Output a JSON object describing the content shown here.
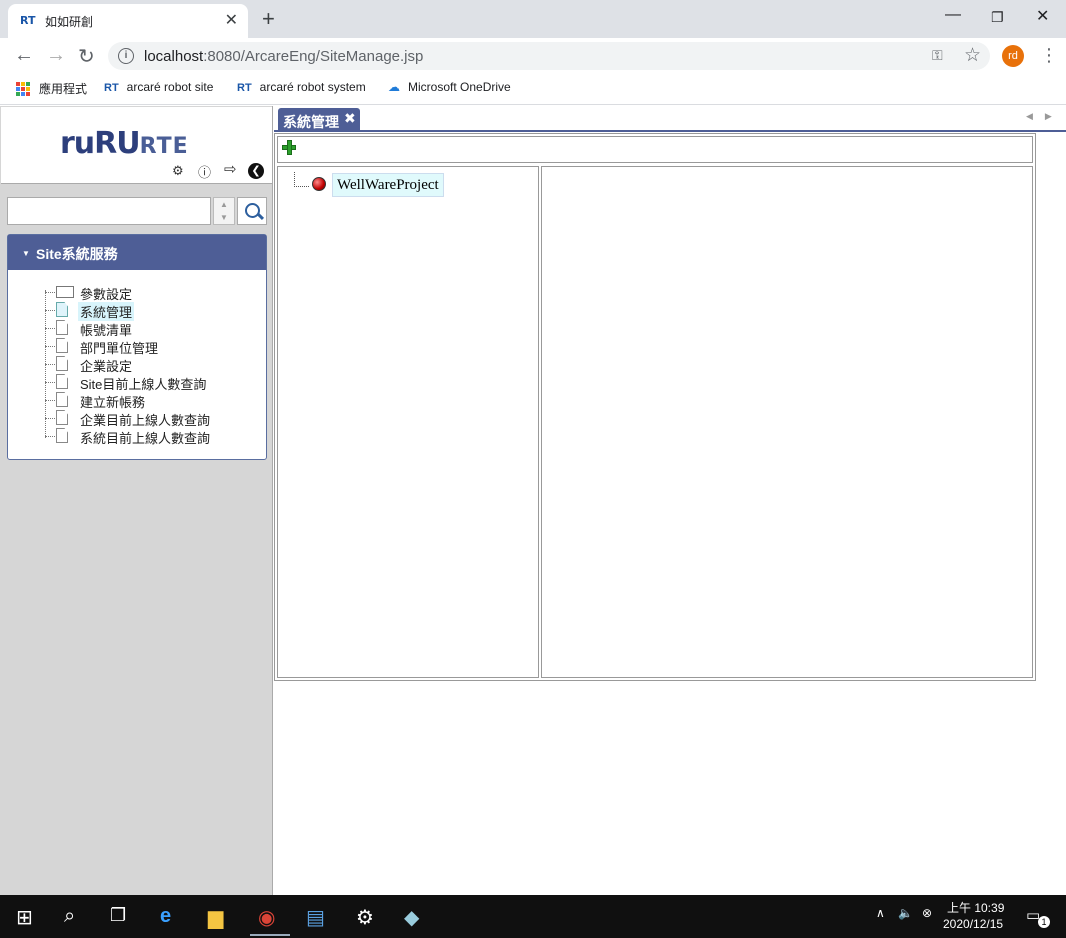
{
  "browser": {
    "tab_title": "如如研創",
    "tab_favicon": "RT",
    "url_host": "localhost",
    "url_rest": ":8080/ArcareEng/SiteManage.jsp",
    "avatar_initials": "rd",
    "bookmarks": [
      {
        "label": "應用程式",
        "icon": "apps-grid-icon"
      },
      {
        "label": "arcaré robot site",
        "icon": "RT"
      },
      {
        "label": "arcaré robot system",
        "icon": "RT"
      },
      {
        "label": "Microsoft OneDrive",
        "icon": "cloud-icon"
      }
    ]
  },
  "app": {
    "logo_main": "ruRU",
    "logo_suffix": "RTE",
    "search_placeholder": "",
    "accordion_title": "Site系統服務",
    "tree": {
      "root": "參數設定",
      "items": [
        {
          "label": "系統管理",
          "selected": true
        },
        {
          "label": "帳號清單",
          "selected": false
        },
        {
          "label": "部門單位管理",
          "selected": false
        },
        {
          "label": "企業設定",
          "selected": false
        },
        {
          "label": "Site目前上線人數查詢",
          "selected": false
        },
        {
          "label": "建立新帳務",
          "selected": false
        },
        {
          "label": "企業目前上線人數查詢",
          "selected": false
        },
        {
          "label": "系統目前上線人數查詢",
          "selected": false
        }
      ]
    },
    "main_tab": {
      "label": "系統管理",
      "close_glyph": "✖"
    },
    "project_tree": {
      "root_label": "WellWareProject"
    }
  },
  "taskbar": {
    "time": "上午 10:39",
    "date": "2020/12/15",
    "notification_count": "1"
  },
  "colors": {
    "accent": "#4e5e96",
    "selected_bg": "#d8f4fb",
    "add_green": "#2ca02c"
  }
}
